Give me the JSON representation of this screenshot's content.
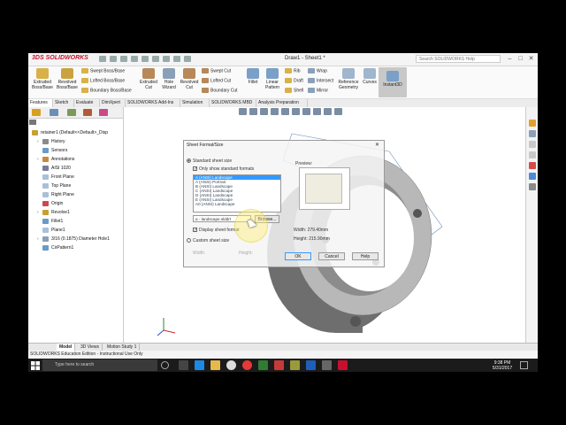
{
  "app": {
    "brand_ds": "3DS",
    "brand": "SOLIDWORKS",
    "document_title": "Draw1 - Sheet1 *",
    "search_placeholder": "Search SOLIDWORKS Help"
  },
  "ribbon": {
    "extruded_boss": "Extruded Boss/Base",
    "revolved_boss": "Revolved Boss/Base",
    "swept_boss": "Swept Boss/Base",
    "lofted_boss": "Lofted Boss/Base",
    "boundary_boss": "Boundary Boss/Base",
    "extruded_cut": "Extruded Cut",
    "hole_wizard": "Hole Wizard",
    "revolved_cut": "Revolved Cut",
    "swept_cut": "Swept Cut",
    "lofted_cut": "Lofted Cut",
    "boundary_cut": "Boundary Cut",
    "fillet": "Fillet",
    "linear_pattern": "Linear Pattern",
    "rib": "Rib",
    "draft": "Draft",
    "shell": "Shell",
    "wrap": "Wrap",
    "intersect": "Intersect",
    "mirror": "Mirror",
    "reference_geometry": "Reference Geometry",
    "curves": "Curves",
    "instant3d": "Instant3D"
  },
  "tabs": [
    "Features",
    "Sketch",
    "Evaluate",
    "DimXpert",
    "SOLIDWORKS Add-Ins",
    "Simulation",
    "SOLIDWORKS MBD",
    "Analysis Preparation"
  ],
  "tree": {
    "root": "retainer1 (Default<<Default>_Disp",
    "items": [
      "History",
      "Sensors",
      "Annotations",
      "AISI 1020",
      "Front Plane",
      "Top Plane",
      "Right Plane",
      "Origin",
      "Revolve1",
      "Fillet1",
      "Plane1",
      "3/16 (0.1875) Diameter Hole1",
      "CirPattern1"
    ]
  },
  "dialog": {
    "title": "Sheet Format/Size",
    "standard_label": "Standard sheet size",
    "only_standard": "Only show standard formats",
    "sheet_options": [
      "A (ANSI) Landscape",
      "A (ANSI) Portrait",
      "B (ANSI) Landscape",
      "C (ANSI) Landscape",
      "D (ANSI) Landscape",
      "E (ANSI) Landscape",
      "A0 (ANSI) Landscape"
    ],
    "selected_index": 0,
    "file_value": "a - landscape.slddrt",
    "browse": "Browse...",
    "display_format": "Display sheet format",
    "custom_label": "Custom sheet size",
    "width_placeholder": "Width:",
    "height_placeholder": "Height:",
    "preview_label": "Preview:",
    "width_label": "Width:",
    "width_value": "279.40mm",
    "height_label": "Height:",
    "height_value": "215.90mm",
    "ok": "OK",
    "cancel": "Cancel",
    "help": "Help"
  },
  "bottom_tabs": [
    "Model",
    "3D Views",
    "Motion Study 1"
  ],
  "status": "SOLIDWORKS Education Edition - Instructional Use Only",
  "taskbar": {
    "search_placeholder": "Type here to search",
    "time": "9:38 PM",
    "date": "5/31/2017"
  },
  "colors": {
    "accent": "#c8102e",
    "selection": "#3399ff",
    "taskbar": "#1b1b1b",
    "part_gray": "#8a8a8a"
  }
}
